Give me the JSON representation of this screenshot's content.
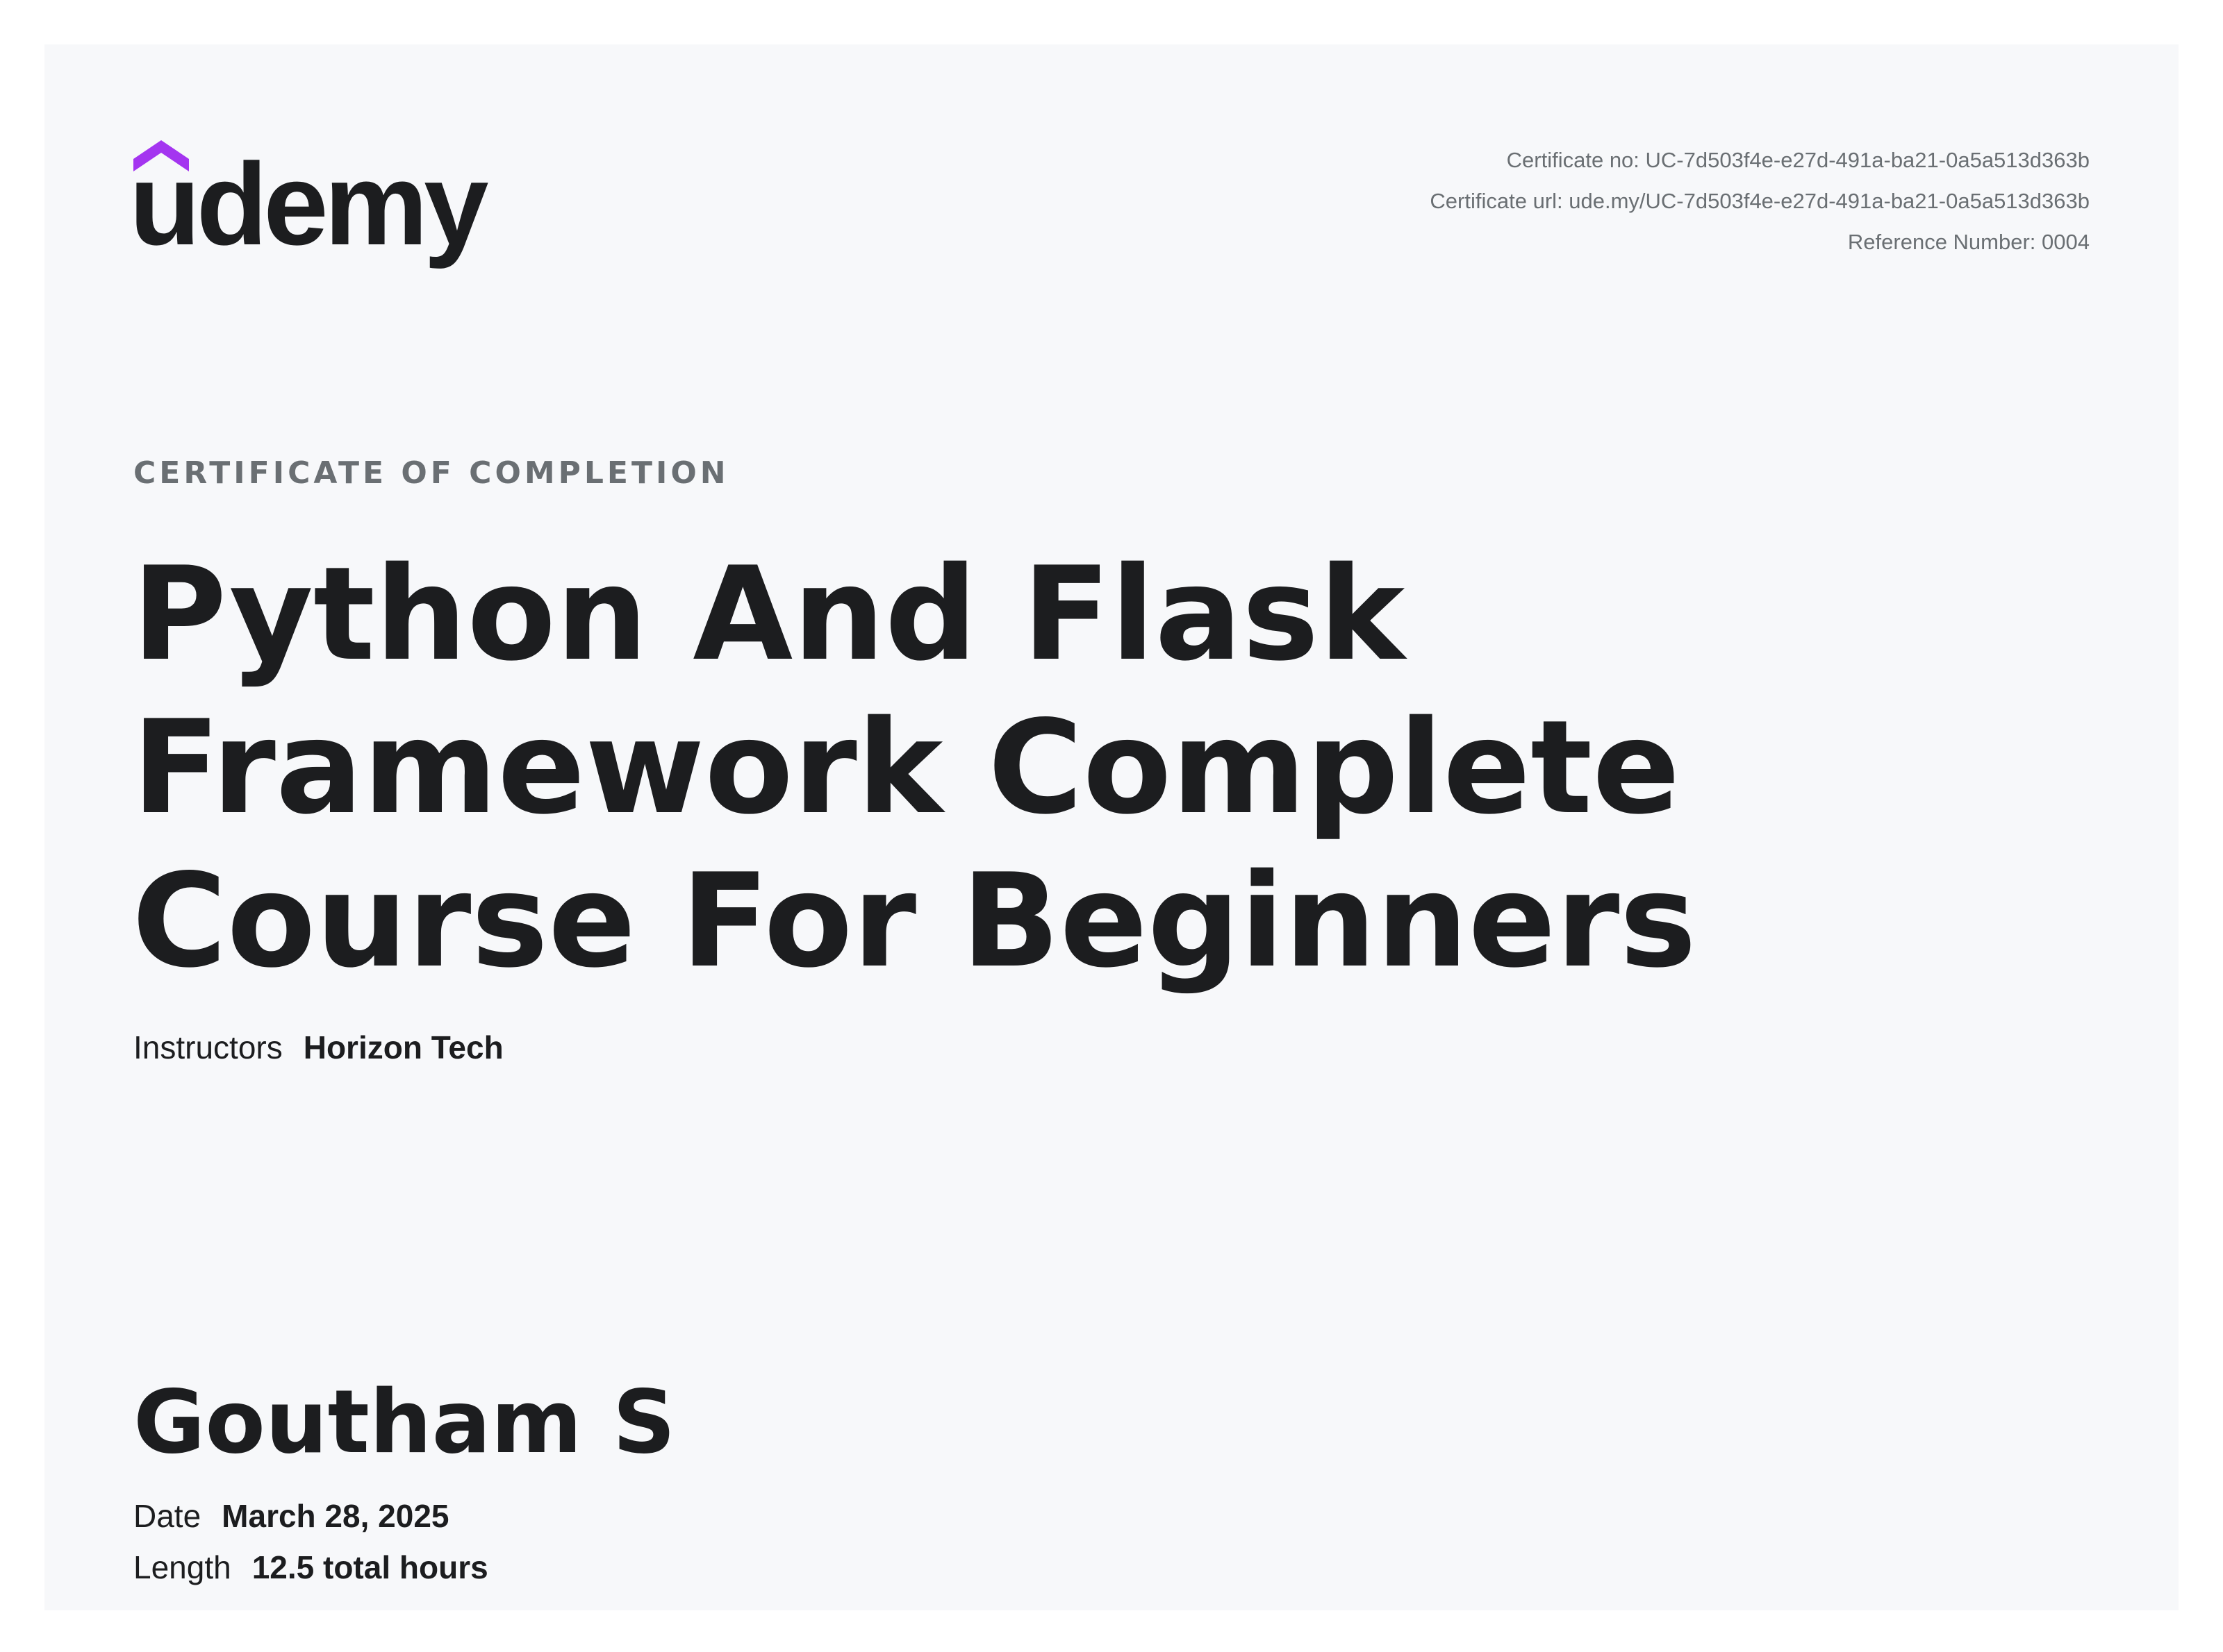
{
  "brand": {
    "logo_text": "udemy",
    "logo_accent_color": "#a435f0",
    "logo_text_color": "#1c1d1f"
  },
  "certificate_meta": {
    "number_line": "Certificate no: UC-7d503f4e-e27d-491a-ba21-0a5a513d363b",
    "url_line": "Certificate url: ude.my/UC-7d503f4e-e27d-491a-ba21-0a5a513d363b",
    "reference_line": "Reference Number: 0004"
  },
  "certificate": {
    "heading": "CERTIFICATE OF COMPLETION",
    "course_title_lines": [
      "Python And Flask",
      "Framework Complete",
      "Course For Beginners"
    ],
    "instructors_label": "Instructors",
    "instructors_value": "Horizon Tech",
    "recipient_name": "Goutham S",
    "date_label": "Date",
    "date_value": "March 28, 2025",
    "length_label": "Length",
    "length_value": "12.5 total hours"
  },
  "colors": {
    "page_background": "#ffffff",
    "certificate_background": "#f7f8fa",
    "muted_text": "#6a6f73",
    "primary_text": "#1c1d1f"
  }
}
